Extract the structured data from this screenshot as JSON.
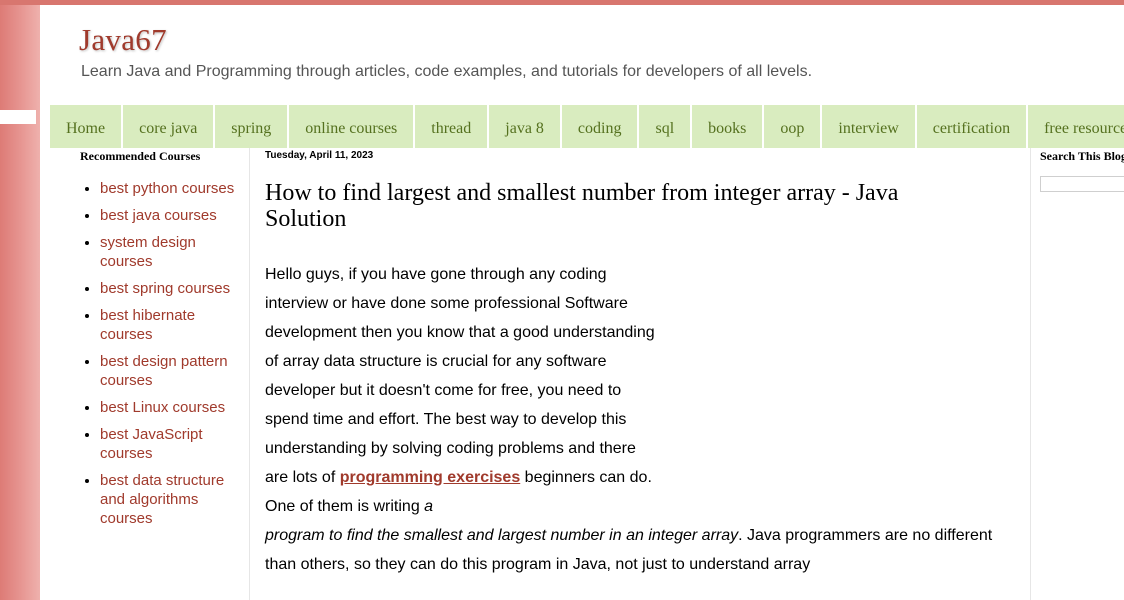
{
  "blog": {
    "title": "Java67",
    "description": "Learn Java and Programming through articles, code examples, and tutorials for developers of all levels."
  },
  "nav": {
    "items": [
      "Home",
      "core java",
      "spring",
      "online courses",
      "thread",
      "java 8",
      "coding",
      "sql",
      "books",
      "oop",
      "interview",
      "certification",
      "free resources"
    ]
  },
  "sidebar": {
    "heading": "Recommended Courses",
    "courses": [
      "best python courses",
      "best java courses",
      "system design courses",
      "best spring courses",
      "best hibernate courses",
      "best design pattern courses",
      "best Linux courses",
      "best JavaScript courses",
      "best data structure and algorithms courses"
    ]
  },
  "post": {
    "date": "Tuesday, April 11, 2023",
    "title": "How to find largest and smallest number from integer array - Java Solution",
    "para1_start": "Hello guys, if you have gone through any coding interview or have done some professional Software development then you know that a good understanding of array data structure is crucial for any software developer but it doesn't come for free, you need to spend time and effort. The best way to develop this understanding by solving coding problems and there are lots of ",
    "link_text": "programming exercises",
    "para1_mid": " beginners can do. One of them is writing ",
    "italic_a": "a",
    "italic_rest": "program to find the smallest and largest number in an integer array",
    "para1_end": ". Java programmers are no different than others, so they can do this program in Java, not just to understand array"
  },
  "search": {
    "heading": "Search This Blog",
    "placeholder": ""
  },
  "colors": {
    "accent": "#a03a2c",
    "nav_bg": "#d9ecbf",
    "nav_text": "#55711f",
    "page_bg": "#dd7b76"
  }
}
